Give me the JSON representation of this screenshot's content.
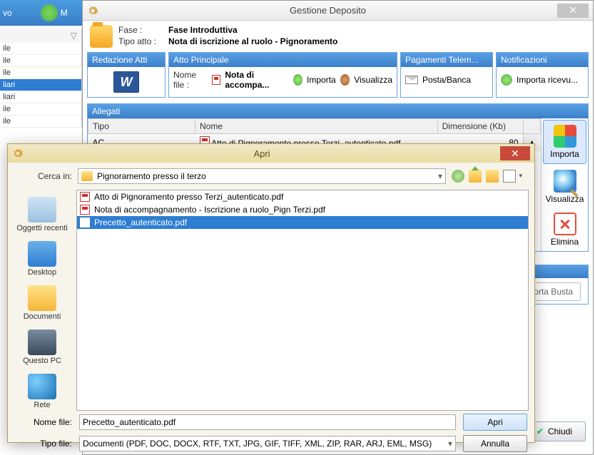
{
  "bg": {
    "top_label": "vo",
    "m_label": "M",
    "filter_icon": "▽",
    "rows": [
      "ile",
      "ile",
      "ile",
      "liari",
      "liari",
      "ile",
      "ile"
    ],
    "selected_index": 3
  },
  "window": {
    "title": "Gestione Deposito",
    "fase_label": "Fase :",
    "fase_value": "Fase Introduttiva",
    "tipo_label": "Tipo atto :",
    "tipo_value": "Nota di iscrizione al ruolo - Pignoramento"
  },
  "panels": {
    "redazione": {
      "title": "Redazione Atti",
      "word": "W"
    },
    "atto": {
      "title": "Atto Principale",
      "nomefile_label": "Nome file :",
      "nomefile_value": "Nota di accompa...",
      "importa": "Importa",
      "visualizza": "Visualizza"
    },
    "pagamenti": {
      "title": "Pagamenti Telem...",
      "posta": "Posta/Banca"
    },
    "notificazioni": {
      "title": "Notificazioni",
      "importa": "Importa ricevu..."
    }
  },
  "allegati": {
    "title": "Allegati",
    "cols": {
      "tipo": "Tipo",
      "nome": "Nome",
      "dim": "Dimensione (Kb)"
    },
    "rows": [
      {
        "tipo": "AC",
        "nome": "Atto di Pignoramento presso Terzi_autenticato.pdf",
        "dim": "80"
      }
    ],
    "side": {
      "importa": "Importa",
      "visualizza": "Visualizza",
      "elimina": "Elimina"
    }
  },
  "bottom": {
    "esporta": "orta Busta"
  },
  "footer": {
    "chiudi": "Chiudi"
  },
  "dialog": {
    "title": "Apri",
    "cercain_label": "Cerca in:",
    "folder": "Pignoramento presso il terzo",
    "places": {
      "recent": "Oggetti recenti",
      "desktop": "Desktop",
      "docs": "Documenti",
      "pc": "Questo PC",
      "net": "Rete"
    },
    "files": [
      "Atto di Pignoramento presso Terzi_autenticato.pdf",
      "Nota di accompagnamento - Iscrizione a ruolo_Pign Terzi.pdf",
      "Precetto_autenticato.pdf"
    ],
    "selected_index": 2,
    "nomefile_label": "Nome file:",
    "nomefile_value": "Precetto_autenticato.pdf",
    "tipofile_label": "Tipo file:",
    "tipofile_value": "Documenti (PDF, DOC, DOCX, RTF, TXT, JPG, GIF, TIFF, XML, ZIP, RAR, ARJ, EML, MSG)",
    "open": "Apri",
    "cancel": "Annulla"
  }
}
